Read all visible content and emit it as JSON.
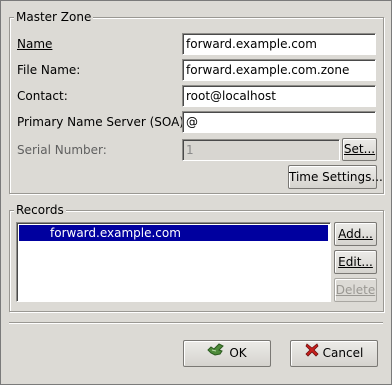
{
  "master_zone": {
    "title": "Master Zone",
    "fields": [
      {
        "label": "Name",
        "value": "forward.example.com"
      },
      {
        "label": "File Name:",
        "value": "forward.example.com.zone"
      },
      {
        "label": "Contact:",
        "value": "root@localhost"
      },
      {
        "label": "Primary Name Server (SOA):",
        "value": "@"
      },
      {
        "label": "Serial Number:",
        "value": "1",
        "disabled": true
      }
    ],
    "set_button": "Set...",
    "time_settings_button": "Time Settings..."
  },
  "records": {
    "title": "Records",
    "items": [
      "forward.example.com"
    ],
    "selected_index": 0,
    "add_button": "Add...",
    "edit_button": "Edit...",
    "delete_button": "Delete",
    "delete_disabled": true
  },
  "footer": {
    "ok_label": "OK",
    "cancel_label": "Cancel"
  },
  "icons": {
    "ok": "ok-hand-icon",
    "cancel": "cancel-x-icon"
  },
  "colors": {
    "selection": "#00009f",
    "dialog_bg": "#dcdad5",
    "ok_icon": "#4e8a3a",
    "cancel_icon": "#c8201e"
  }
}
